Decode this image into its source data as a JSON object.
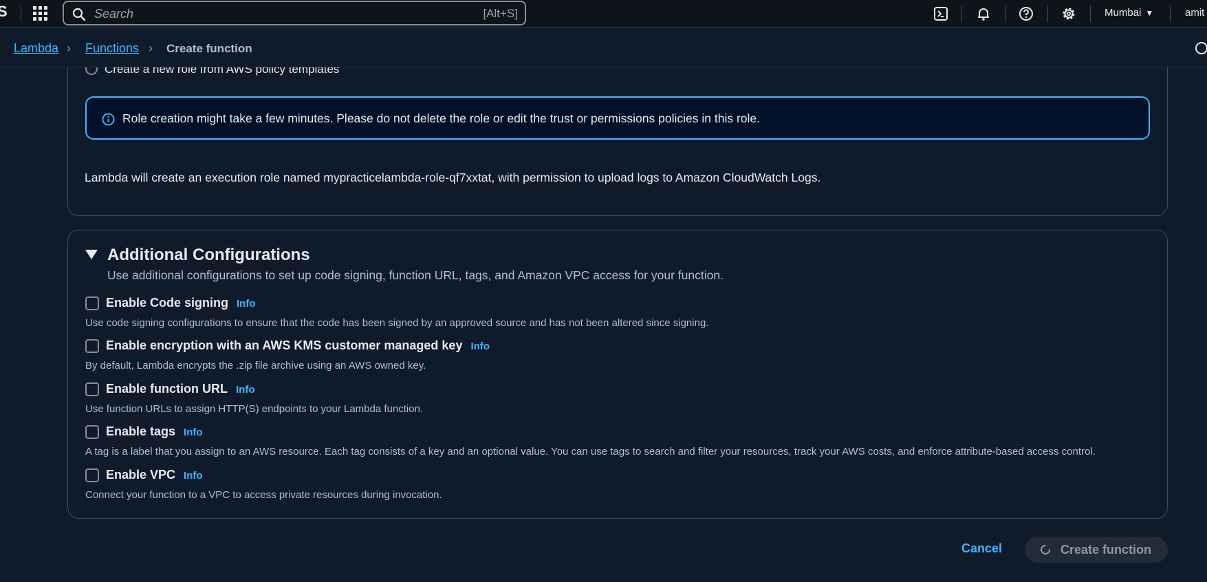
{
  "topbar": {
    "logo_fragment": "S",
    "search_placeholder": "Search",
    "search_shortcut": "[Alt+S]",
    "region": "Mumbai",
    "user": "amit"
  },
  "breadcrumb": {
    "items": [
      "Lambda",
      "Functions"
    ],
    "current": "Create function"
  },
  "execution_role": {
    "radio_label": "Create a new role from AWS policy templates",
    "alert_text": "Role creation might take a few minutes. Please do not delete the role or edit the trust or permissions policies in this role.",
    "note": "Lambda will create an execution role named mypracticelambda-role-qf7xxtat, with permission to upload logs to Amazon CloudWatch Logs."
  },
  "additional": {
    "title": "Additional Configurations",
    "description": "Use additional configurations to set up code signing, function URL, tags, and Amazon VPC access for your function.",
    "info_label": "Info",
    "options": [
      {
        "label": "Enable Code signing",
        "desc": "Use code signing configurations to ensure that the code has been signed by an approved source and has not been altered since signing."
      },
      {
        "label": "Enable encryption with an AWS KMS customer managed key",
        "desc": "By default, Lambda encrypts the .zip file archive using an AWS owned key."
      },
      {
        "label": "Enable function URL",
        "desc": "Use function URLs to assign HTTP(S) endpoints to your Lambda function."
      },
      {
        "label": "Enable tags",
        "desc": "A tag is a label that you assign to an AWS resource. Each tag consists of a key and an optional value. You can use tags to search and filter your resources, track your AWS costs, and enforce attribute-based access control."
      },
      {
        "label": "Enable VPC",
        "desc": "Connect your function to a VPC to access private resources during invocation."
      }
    ]
  },
  "actions": {
    "cancel": "Cancel",
    "create": "Create function"
  },
  "colors": {
    "accent": "#42b4ff",
    "background": "#0f1b2a",
    "topbar": "#0f141a"
  }
}
